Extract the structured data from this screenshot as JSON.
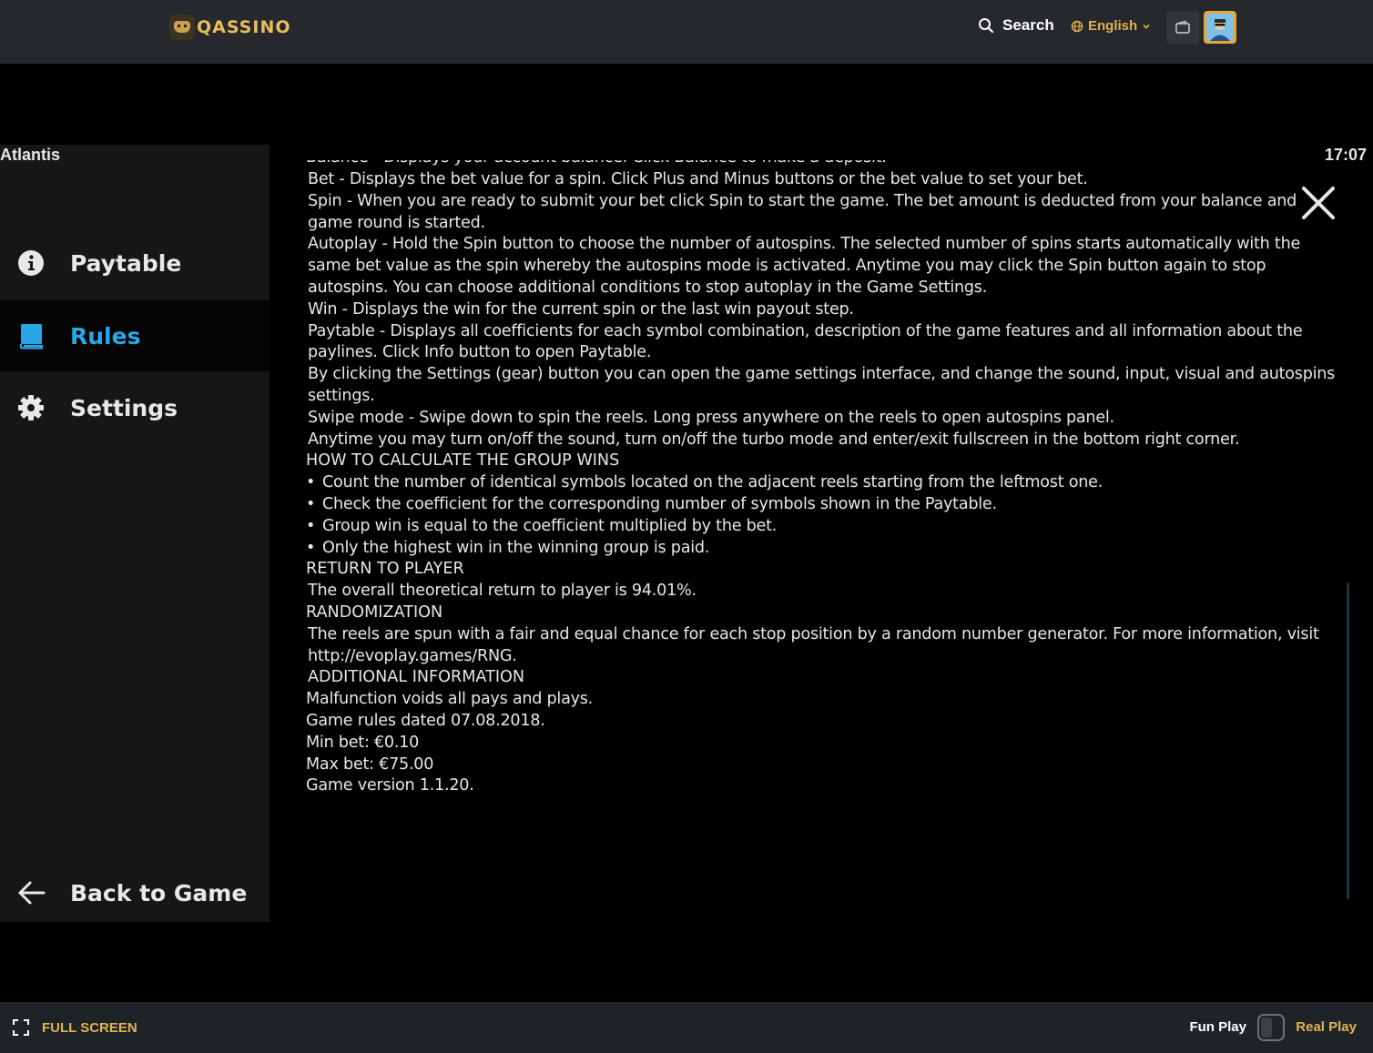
{
  "header": {
    "logo_text": "QASSINO",
    "search_label": "Search",
    "language": "English"
  },
  "game": {
    "title": "Atlantis",
    "clock": "17:07"
  },
  "sidebar": {
    "items": [
      {
        "label": "Paytable",
        "icon": "info-icon"
      },
      {
        "label": "Rules",
        "icon": "book-icon",
        "active": true
      },
      {
        "label": "Settings",
        "icon": "gear-icon"
      }
    ],
    "back_label": "Back to Game"
  },
  "rules": {
    "cut_line": "Balance - Displays your account balance. Click Balance to make a deposit.",
    "controls": [
      "Bet - Displays the bet value for a spin. Click Plus and Minus buttons or the bet value to set your bet.",
      "Spin - When you are ready to submit your bet click Spin to start the game. The bet amount is deducted from your balance and game round is started.",
      "Autoplay - Hold the Spin button to choose the number of autospins. The selected number of spins starts automatically with the same bet value as the spin whereby the autospins mode is activated. Anytime you may click the Spin button again to stop autospins. You can choose additional conditions to stop autoplay in the Game Settings.",
      "Win - Displays the win for the current spin or the last win payout step.",
      "Paytable - Displays all coefficients for each symbol combination, description of the game features and all information about the paylines. Click Info button to open Paytable.",
      "By clicking the Settings (gear) button you can open the game settings interface, and change the sound, input, visual and autospins settings.",
      "Swipe mode - Swipe down to spin the reels. Long press anywhere on the reels to open autospins panel.",
      "Anytime you may turn on/off the sound, turn on/off the turbo mode and enter/exit fullscreen in the bottom right corner."
    ],
    "group_wins": {
      "heading": "HOW TO CALCULATE THE GROUP WINS",
      "bullets": [
        "Count the number of identical symbols located on the adjacent reels starting from the leftmost one.",
        "Check the coefficient for the corresponding number of symbols shown in the Paytable.",
        "Group win is equal to the coefficient multiplied by the bet.",
        "Only the highest win in the winning group is paid."
      ]
    },
    "rtp": {
      "heading": "RETURN TO PLAYER",
      "text": "The overall theoretical return to player is 94.01%."
    },
    "randomization": {
      "heading": "RANDOMIZATION",
      "text": "The reels are spun with a fair and equal chance for each stop position by a random number generator. For more information, visit http://evoplay.games/RNG."
    },
    "additional": {
      "heading": "ADDITIONAL INFORMATION",
      "lines": [
        "Malfunction voids all pays and plays.",
        "Game rules dated 07.08.2018.",
        "Min bet: €0.10",
        "Max bet: €75.00",
        "Game version 1.1.20."
      ]
    }
  },
  "footer": {
    "fullscreen_label": "FULL SCREEN",
    "fun_label": "Fun Play",
    "real_label": "Real Play"
  },
  "colors": {
    "accent_gold": "#e2b34e",
    "active_blue": "#29a6e6",
    "header_bg": "#25282c",
    "sidebar_bg": "#161616"
  }
}
